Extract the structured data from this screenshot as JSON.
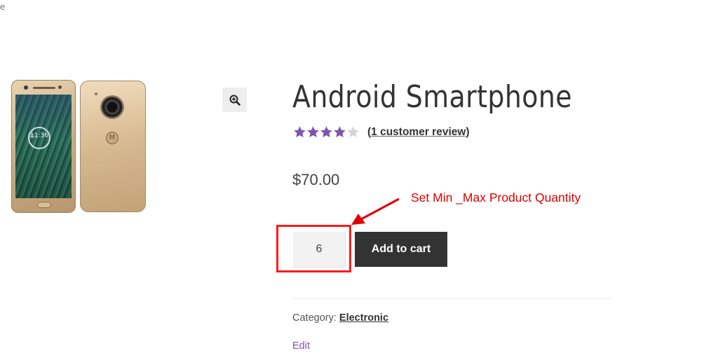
{
  "page": {
    "edge_char": "e"
  },
  "gallery": {
    "lock_screen_time": "11:36",
    "zoom_icon": "magnifier-plus-icon"
  },
  "product": {
    "title": "Android Smartphone",
    "rating": {
      "value": 4,
      "max": 5,
      "filled_color": "#7f54b3",
      "empty_color": "#d4d4d4"
    },
    "review_link": "(1 customer review)",
    "price": "$70.00",
    "quantity": "6",
    "add_to_cart_label": "Add to cart",
    "category_label": "Category:",
    "category_value": "Electronic",
    "edit_label": "Edit"
  },
  "annotation": {
    "text": "Set Min _Max Product Quantity",
    "color": "#e00000"
  }
}
